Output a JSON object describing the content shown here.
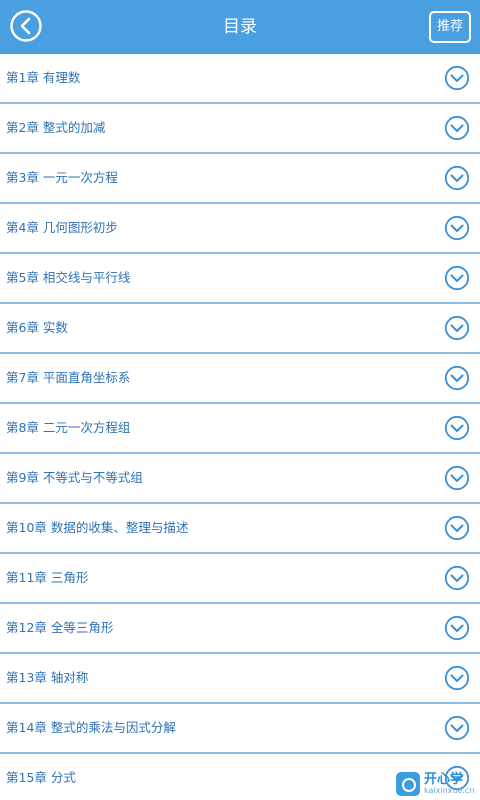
{
  "header": {
    "title": "目录",
    "recommend_label": "推荐",
    "back_icon": "chevron-left-circle-icon"
  },
  "colors": {
    "header_bg": "#4a9fe0",
    "text": "#2f72b6",
    "divider": "#8bbde4",
    "icon": "#3a8fd4"
  },
  "chapters": [
    {
      "label": "第1章 有理数",
      "icon": "chevron-down-circle-icon"
    },
    {
      "label": "第2章 整式的加减",
      "icon": "chevron-down-circle-icon"
    },
    {
      "label": "第3章 一元一次方程",
      "icon": "chevron-down-circle-icon"
    },
    {
      "label": "第4章 几何图形初步",
      "icon": "chevron-down-circle-icon"
    },
    {
      "label": "第5章 相交线与平行线",
      "icon": "chevron-down-circle-icon"
    },
    {
      "label": "第6章 实数",
      "icon": "chevron-down-circle-icon"
    },
    {
      "label": "第7章 平面直角坐标系",
      "icon": "chevron-down-circle-icon"
    },
    {
      "label": "第8章 二元一次方程组",
      "icon": "chevron-down-circle-icon"
    },
    {
      "label": "第9章 不等式与不等式组",
      "icon": "chevron-down-circle-icon"
    },
    {
      "label": "第10章 数据的收集、整理与描述",
      "icon": "chevron-down-circle-icon"
    },
    {
      "label": "第11章 三角形",
      "icon": "chevron-down-circle-icon"
    },
    {
      "label": "第12章 全等三角形",
      "icon": "chevron-down-circle-icon"
    },
    {
      "label": "第13章 轴对称",
      "icon": "chevron-down-circle-icon"
    },
    {
      "label": "第14章 整式的乘法与因式分解",
      "icon": "chevron-down-circle-icon"
    },
    {
      "label": "第15章 分式",
      "icon": "chevron-down-circle-icon"
    }
  ],
  "watermark": {
    "name": "开心学",
    "domain": "kaixinxue.cn"
  }
}
